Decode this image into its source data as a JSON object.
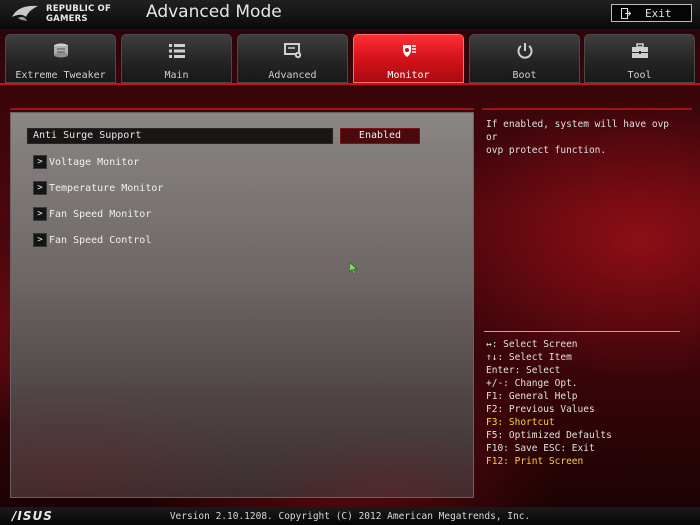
{
  "header": {
    "brand_line1": "REPUBLIC OF",
    "brand_line2": "GAMERS",
    "mode_title": "Advanced Mode",
    "exit_label": "Exit"
  },
  "tabs": [
    {
      "label": "Extreme Tweaker",
      "icon": "cpu-icon",
      "active": false
    },
    {
      "label": "Main",
      "icon": "list-icon",
      "active": false
    },
    {
      "label": "Advanced",
      "icon": "advanced-settings-icon",
      "active": false
    },
    {
      "label": "Monitor",
      "icon": "monitor-gauge-icon",
      "active": true
    },
    {
      "label": "Boot",
      "icon": "power-icon",
      "active": false
    },
    {
      "label": "Tool",
      "icon": "toolbox-icon",
      "active": false
    }
  ],
  "main": {
    "anti_surge": {
      "label": "Anti Surge Support",
      "value": "Enabled"
    },
    "submenus": [
      {
        "label": "Voltage Monitor",
        "arrow": ">"
      },
      {
        "label": "Temperature Monitor",
        "arrow": ">"
      },
      {
        "label": "Fan Speed Monitor",
        "arrow": ">"
      },
      {
        "label": "Fan Speed Control",
        "arrow": ">"
      }
    ]
  },
  "help": {
    "line1": "If enabled, system will have ovp or",
    "line2": "ovp protect function."
  },
  "keys": [
    {
      "text": "↔: Select Screen",
      "highlight": false
    },
    {
      "text": "↑↓: Select Item",
      "highlight": false
    },
    {
      "text": "Enter: Select",
      "highlight": false
    },
    {
      "text": "+/-: Change Opt.",
      "highlight": false
    },
    {
      "text": "F1: General Help",
      "highlight": false
    },
    {
      "text": "F2: Previous Values",
      "highlight": false
    },
    {
      "text": "F3: Shortcut",
      "highlight": true
    },
    {
      "text": "F5: Optimized Defaults",
      "highlight": false
    },
    {
      "text": "F10: Save  ESC: Exit",
      "highlight": false
    },
    {
      "text": "F12: Print Screen",
      "highlight": true
    }
  ],
  "footer": {
    "logo": "/ISUS",
    "copyright": "Version 2.10.1208. Copyright (C) 2012 American Megatrends, Inc."
  },
  "colors": {
    "accent_red": "#d8141c",
    "highlight_yellow": "#ffd23a"
  }
}
